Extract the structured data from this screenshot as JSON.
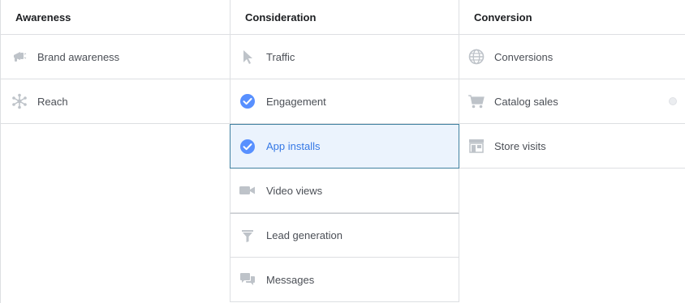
{
  "columns": [
    {
      "title": "Awareness",
      "items": [
        {
          "label": "Brand awareness",
          "icon": "megaphone-icon"
        },
        {
          "label": "Reach",
          "icon": "reach-icon"
        }
      ]
    },
    {
      "title": "Consideration",
      "items": [
        {
          "label": "Traffic",
          "icon": "cursor-icon"
        },
        {
          "label": "Engagement",
          "icon": "check-circle-icon"
        },
        {
          "label": "App installs",
          "icon": "check-circle-icon",
          "selected": true
        },
        {
          "label": "Video views",
          "icon": "video-camera-icon"
        },
        {
          "label": "Lead generation",
          "icon": "funnel-icon"
        },
        {
          "label": "Messages",
          "icon": "chat-bubbles-icon"
        }
      ]
    },
    {
      "title": "Conversion",
      "items": [
        {
          "label": "Conversions",
          "icon": "globe-icon"
        },
        {
          "label": "Catalog sales",
          "icon": "shopping-cart-icon"
        },
        {
          "label": "Store visits",
          "icon": "storefront-icon"
        }
      ]
    }
  ],
  "colors": {
    "icon_gray": "#bec3c9",
    "check_blue": "#5890ff",
    "selected_bg": "#ebf3fd",
    "selected_text": "#3578e5",
    "border": "#dddfe2"
  }
}
